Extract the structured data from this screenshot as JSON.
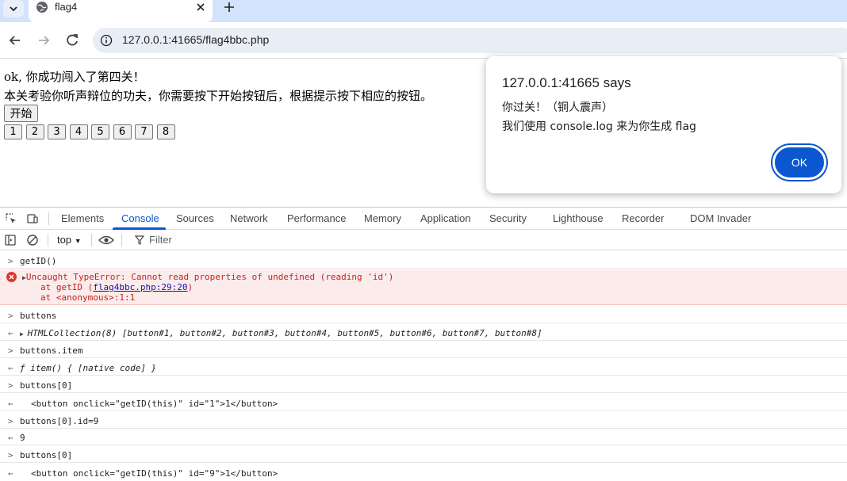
{
  "tab": {
    "title": "flag4"
  },
  "omnibox": {
    "url": "127.0.0.1:41665/flag4bbc.php"
  },
  "page": {
    "line1": "ok, 你成功闯入了第四关！",
    "line2": "本关考验你听声辩位的功夫，你需要按下开始按钮后，根据提示按下相应的按钮。",
    "start_label": "开始",
    "number_buttons": [
      "1",
      "2",
      "3",
      "4",
      "5",
      "6",
      "7",
      "8"
    ]
  },
  "dialog": {
    "title": "127.0.0.1:41665 says",
    "message_line1": "你过关！（铜人震声）",
    "message_line2": "我们使用 console.log 来为你生成 flag",
    "ok_label": "OK"
  },
  "devtools": {
    "tabs": [
      "Elements",
      "Console",
      "Sources",
      "Network",
      "Performance",
      "Memory",
      "Application",
      "Security",
      "Lighthouse",
      "Recorder",
      "DOM Invader"
    ],
    "active_tab": "Console",
    "context": "top",
    "filter_placeholder": "Filter"
  },
  "console": {
    "r1_in": "getID()",
    "r2_err": "Uncaught TypeError: Cannot read properties of undefined (reading 'id')",
    "r2_at1_prefix": "at getID (",
    "r2_at1_link": "flag4bbc.php:29:20",
    "r2_at1_suffix": ")",
    "r2_at2": "at <anonymous>:1:1",
    "r3_in": "buttons",
    "r4_out": "HTMLCollection(8) [button#1, button#2, button#3, button#4, button#5, button#6, button#7, button#8]",
    "r5_in": "buttons.item",
    "r6_out": "ƒ item() { [native code] }",
    "r7_in": "buttons[0]",
    "r8_out": "<button onclick=\"getID(this)\" id=\"1\">1</button>",
    "r9_in": "buttons[0].id=9",
    "r10_out": "9",
    "r11_in": "buttons[0]",
    "r12_out": "<button onclick=\"getID(this)\" id=\"9\">1</button>"
  },
  "colors": {
    "tabstrip": "#d3e3fd",
    "accent": "#0b57d0",
    "error_bg": "#fcebeb",
    "error_text": "#c5221f"
  }
}
